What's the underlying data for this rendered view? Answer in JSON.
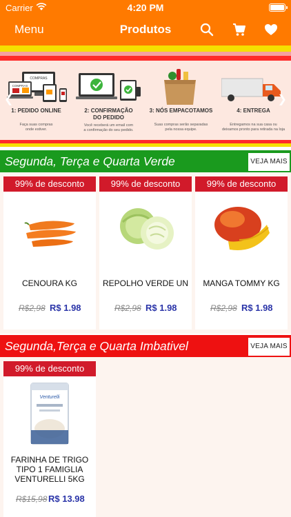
{
  "status_bar": {
    "carrier": "Carrier",
    "time": "4:20 PM"
  },
  "nav": {
    "menu_label": "Menu",
    "title": "Produtos"
  },
  "banner": {
    "steps": [
      {
        "screen_text": "COMPRAS",
        "screen_text2": "COMPRAS",
        "label_lines": [
          "1: PEDIDO ONLINE"
        ],
        "desc": [
          "Faça suas compras",
          "onde estiver."
        ]
      },
      {
        "label_lines": [
          "2: CONFIRMAÇÃO",
          "DO PEDIDO"
        ],
        "desc": [
          "Você receberá um email com",
          "a confirmação do seu pedido."
        ]
      },
      {
        "label_lines": [
          "3: NÓS EMPACOTAMOS"
        ],
        "desc": [
          "Suas compras serão separadas",
          "pela nossa equipe."
        ]
      },
      {
        "label_lines": [
          "4: ENTREGA"
        ],
        "desc": [
          "Entregamos na sua casa ou",
          "deixamos pronto para retirada na loja"
        ]
      }
    ]
  },
  "sections": [
    {
      "title": "Segunda, Terça e Quarta Verde",
      "more_label": "VEJA MAIS",
      "color": "#1a9a1e",
      "products": [
        {
          "badge": "99% de desconto",
          "name": "CENOURA KG",
          "old_price": "R$2,98",
          "price": "R$ 1.98",
          "icon": "carrot-image"
        },
        {
          "badge": "99% de desconto",
          "name": "REPOLHO VERDE UN",
          "old_price": "R$2,98",
          "price": "R$ 1.98",
          "icon": "cabbage-image"
        },
        {
          "badge": "99% de desconto",
          "name": "MANGA TOMMY KG",
          "old_price": "R$2,98",
          "price": "R$ 1.98",
          "icon": "mango-image"
        }
      ]
    },
    {
      "title": "Segunda,Terça e Quarta Imbativel",
      "more_label": "VEJA MAIS",
      "color": "#ee1111",
      "products": [
        {
          "badge": "99% de desconto",
          "name": "FARINHA DE TRIGO TIPO 1 FAMIGLIA VENTURELLI 5KG",
          "name_lines": [
            "FARINHA DE TRIGO",
            "TIPO 1 FAMIGLIA",
            "VENTURELLI 5KG"
          ],
          "old_price": "R$15,98",
          "price": "R$ 13.98",
          "icon": "flour-bag-image",
          "brand": "Venturelli"
        }
      ]
    }
  ],
  "colors": {
    "orange": "#ff7a00",
    "red": "#d11a2a",
    "price_blue": "#2a34a8"
  }
}
